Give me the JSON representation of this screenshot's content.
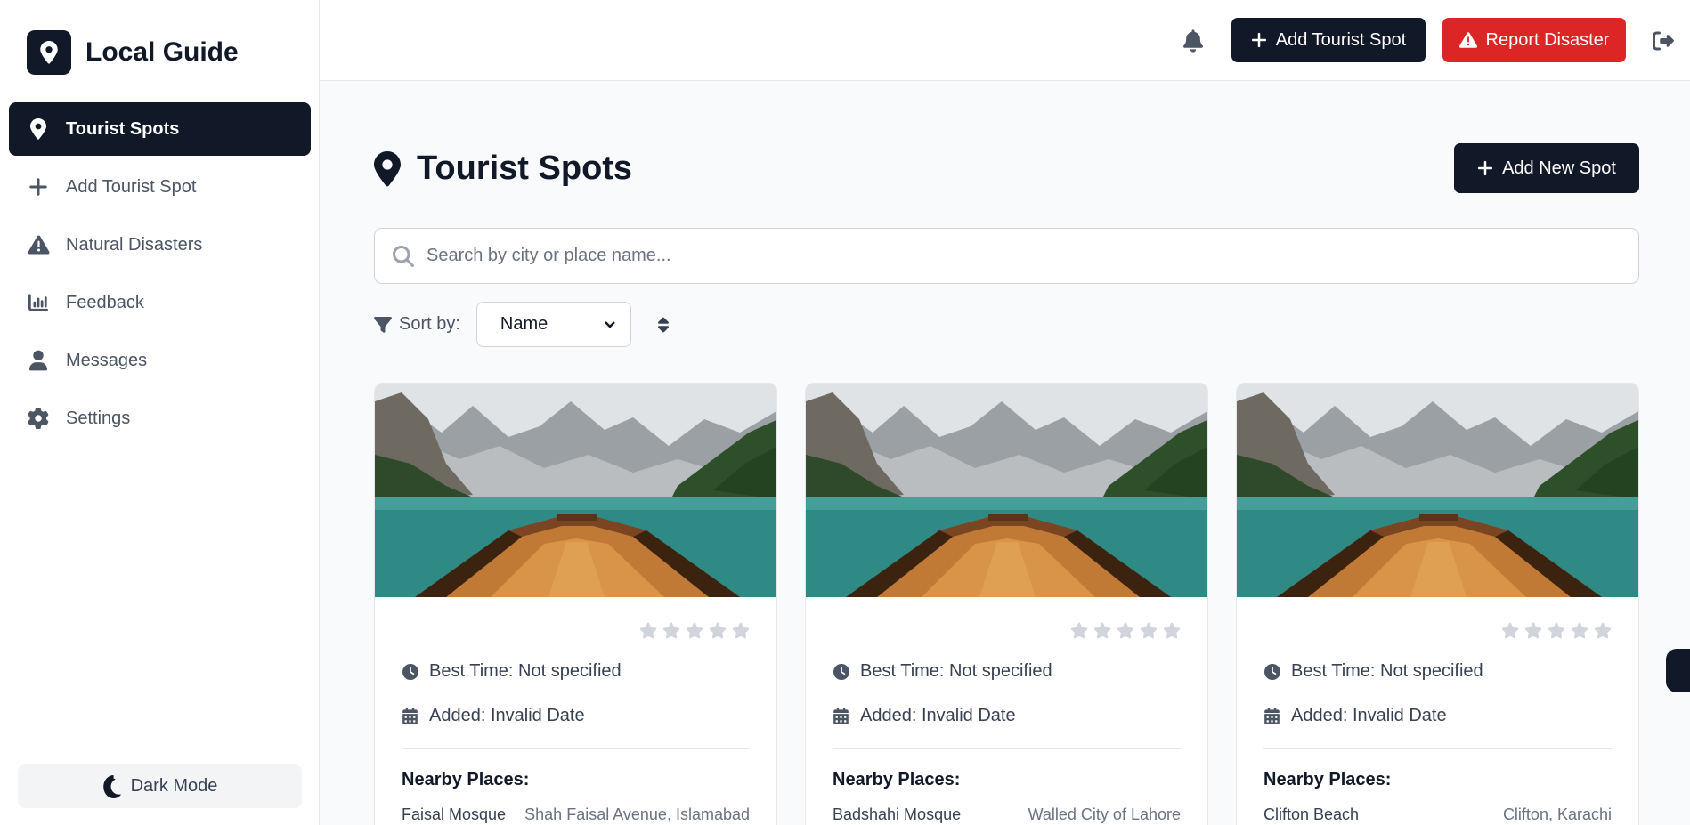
{
  "brand": {
    "title": "Local Guide",
    "icon": "map-pin-icon"
  },
  "sidebar": {
    "items": [
      {
        "label": "Tourist Spots",
        "icon": "map-pin-icon",
        "active": true
      },
      {
        "label": "Add Tourist Spot",
        "icon": "plus-icon",
        "active": false
      },
      {
        "label": "Natural Disasters",
        "icon": "warning-icon",
        "active": false
      },
      {
        "label": "Feedback",
        "icon": "bar-chart-icon",
        "active": false
      },
      {
        "label": "Messages",
        "icon": "user-icon",
        "active": false
      },
      {
        "label": "Settings",
        "icon": "gear-icon",
        "active": false
      }
    ],
    "dark_mode_label": "Dark Mode"
  },
  "topbar": {
    "add_label": "Add Tourist Spot",
    "report_label": "Report Disaster"
  },
  "main": {
    "title": "Tourist Spots",
    "add_new_label": "Add New Spot",
    "search_placeholder": "Search by city or place name...",
    "sort_label": "Sort by:",
    "sort_value": "Name"
  },
  "cards": [
    {
      "rating": 0,
      "best_time": "Best Time: Not specified",
      "added": "Added: Invalid Date",
      "nearby_title": "Nearby Places:",
      "nearby": [
        {
          "name": "Faisal Mosque",
          "location": "Shah Faisal Avenue, Islamabad"
        }
      ]
    },
    {
      "rating": 0,
      "best_time": "Best Time: Not specified",
      "added": "Added: Invalid Date",
      "nearby_title": "Nearby Places:",
      "nearby": [
        {
          "name": "Badshahi Mosque",
          "location": "Walled City of Lahore"
        }
      ]
    },
    {
      "rating": 0,
      "best_time": "Best Time: Not specified",
      "added": "Added: Invalid Date",
      "nearby_title": "Nearby Places:",
      "nearby": [
        {
          "name": "Clifton Beach",
          "location": "Clifton, Karachi"
        }
      ]
    }
  ],
  "colors": {
    "primary": "#111827",
    "danger": "#dc2626",
    "star_empty": "#d1d5db",
    "muted": "#6b7280"
  }
}
